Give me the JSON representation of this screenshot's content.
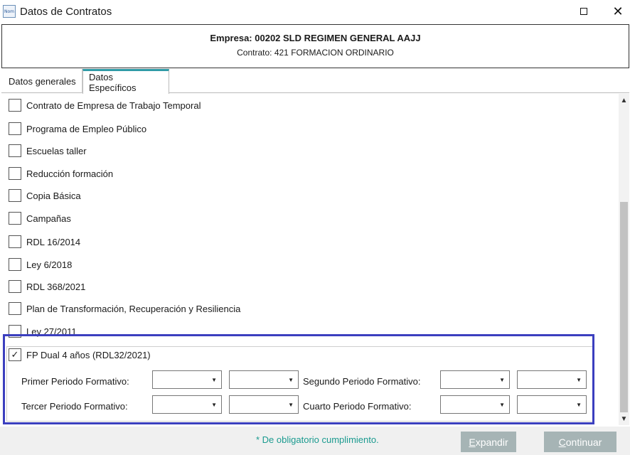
{
  "window": {
    "icon_text": "Nom",
    "title": "Datos de Contratos",
    "maximize_icon": "maximize-icon",
    "close_glyph": "✕"
  },
  "header": {
    "empresa": "Empresa: 00202 SLD REGIMEN GENERAL AAJJ",
    "contrato": "Contrato: 421 FORMACION ORDINARIO"
  },
  "tabs": [
    {
      "label": "Datos generales",
      "active": false
    },
    {
      "label": "Datos Específicos",
      "active": true
    }
  ],
  "checkboxes": [
    {
      "label": "Contrato de Empresa de Trabajo Temporal",
      "checked": false
    },
    {
      "label": "Programa de Empleo Público",
      "checked": false
    },
    {
      "label": "Escuelas taller",
      "checked": false
    },
    {
      "label": "Reducción formación",
      "checked": false
    },
    {
      "label": "Copia Básica",
      "checked": false
    },
    {
      "label": "Campañas",
      "checked": false
    },
    {
      "label": "RDL 16/2014",
      "checked": false
    },
    {
      "label": "Ley 6/2018",
      "checked": false
    },
    {
      "label": "RDL 368/2021",
      "checked": false
    },
    {
      "label": "Plan de Transformación, Recuperación y Resiliencia",
      "checked": false
    },
    {
      "label": "Ley 27/2011",
      "checked": false
    }
  ],
  "fp_dual": {
    "label": "FP Dual 4 años (RDL32/2021)",
    "checked": true,
    "check_glyph": "✓",
    "periods": {
      "primer": "Primer  Periodo Formativo:",
      "segundo": "Segundo  Periodo Formativo:",
      "tercer": "Tercer  Periodo Formativo:",
      "cuarto": "Cuarto  Periodo Formativo:"
    },
    "combo_values": [
      "",
      "",
      "",
      "",
      "",
      "",
      "",
      ""
    ]
  },
  "footer": {
    "required_note": "* De obligatorio cumplimiento.",
    "expandir_first": "E",
    "expandir_rest": "xpandir",
    "continuar_first": "C",
    "continuar_rest": "ontinuar"
  },
  "colors": {
    "highlight": "#3b3fbf",
    "tab_accent": "#2e9aa6",
    "required_text": "#1a9a8f",
    "button_bg": "#a6b4b5"
  }
}
